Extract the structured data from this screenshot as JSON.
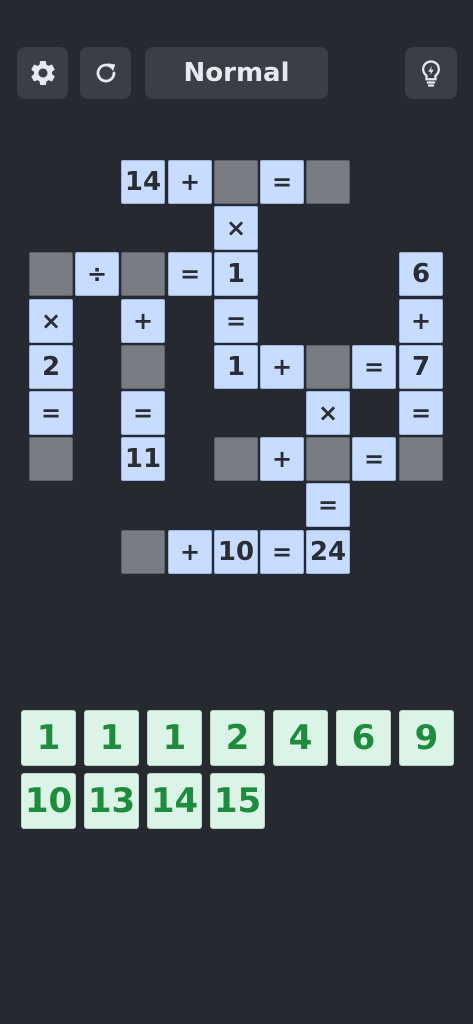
{
  "header": {
    "settings_icon": "gear-icon",
    "restart_icon": "restart-icon",
    "mode_label": "Normal",
    "hint_icon": "lightbulb-icon"
  },
  "board": {
    "cells": [
      {
        "row": 0,
        "col": 2,
        "kind": "fixed",
        "text": "14"
      },
      {
        "row": 0,
        "col": 3,
        "kind": "op",
        "text": "+"
      },
      {
        "row": 0,
        "col": 4,
        "kind": "empty",
        "text": ""
      },
      {
        "row": 0,
        "col": 5,
        "kind": "op",
        "text": "="
      },
      {
        "row": 0,
        "col": 6,
        "kind": "empty",
        "text": ""
      },
      {
        "row": 1,
        "col": 4,
        "kind": "op",
        "text": "×"
      },
      {
        "row": 2,
        "col": 0,
        "kind": "empty",
        "text": ""
      },
      {
        "row": 2,
        "col": 1,
        "kind": "op",
        "text": "÷"
      },
      {
        "row": 2,
        "col": 2,
        "kind": "empty",
        "text": ""
      },
      {
        "row": 2,
        "col": 3,
        "kind": "op",
        "text": "="
      },
      {
        "row": 2,
        "col": 4,
        "kind": "fixed",
        "text": "1"
      },
      {
        "row": 2,
        "col": 8,
        "kind": "fixed",
        "text": "6"
      },
      {
        "row": 3,
        "col": 0,
        "kind": "op",
        "text": "×"
      },
      {
        "row": 3,
        "col": 2,
        "kind": "op",
        "text": "+"
      },
      {
        "row": 3,
        "col": 4,
        "kind": "op",
        "text": "="
      },
      {
        "row": 3,
        "col": 8,
        "kind": "op",
        "text": "+"
      },
      {
        "row": 4,
        "col": 0,
        "kind": "fixed",
        "text": "2"
      },
      {
        "row": 4,
        "col": 2,
        "kind": "empty",
        "text": ""
      },
      {
        "row": 4,
        "col": 4,
        "kind": "fixed",
        "text": "1"
      },
      {
        "row": 4,
        "col": 5,
        "kind": "op",
        "text": "+"
      },
      {
        "row": 4,
        "col": 6,
        "kind": "empty",
        "text": ""
      },
      {
        "row": 4,
        "col": 7,
        "kind": "op",
        "text": "="
      },
      {
        "row": 4,
        "col": 8,
        "kind": "fixed",
        "text": "7"
      },
      {
        "row": 5,
        "col": 0,
        "kind": "op",
        "text": "="
      },
      {
        "row": 5,
        "col": 2,
        "kind": "op",
        "text": "="
      },
      {
        "row": 5,
        "col": 6,
        "kind": "op",
        "text": "×"
      },
      {
        "row": 5,
        "col": 8,
        "kind": "op",
        "text": "="
      },
      {
        "row": 6,
        "col": 0,
        "kind": "empty",
        "text": ""
      },
      {
        "row": 6,
        "col": 2,
        "kind": "fixed",
        "text": "11"
      },
      {
        "row": 6,
        "col": 4,
        "kind": "empty",
        "text": ""
      },
      {
        "row": 6,
        "col": 5,
        "kind": "op",
        "text": "+"
      },
      {
        "row": 6,
        "col": 6,
        "kind": "empty",
        "text": ""
      },
      {
        "row": 6,
        "col": 7,
        "kind": "op",
        "text": "="
      },
      {
        "row": 6,
        "col": 8,
        "kind": "empty",
        "text": ""
      },
      {
        "row": 7,
        "col": 6,
        "kind": "op",
        "text": "="
      },
      {
        "row": 8,
        "col": 2,
        "kind": "empty",
        "text": ""
      },
      {
        "row": 8,
        "col": 3,
        "kind": "op",
        "text": "+"
      },
      {
        "row": 8,
        "col": 4,
        "kind": "fixed",
        "text": "10"
      },
      {
        "row": 8,
        "col": 5,
        "kind": "op",
        "text": "="
      },
      {
        "row": 8,
        "col": 6,
        "kind": "fixed",
        "text": "24"
      }
    ]
  },
  "tray": {
    "tiles": [
      "1",
      "1",
      "1",
      "2",
      "4",
      "6",
      "9",
      "10",
      "13",
      "14",
      "15"
    ]
  },
  "colors": {
    "background": "#272930",
    "button": "#3b3e46",
    "cell_fixed": "#c7dcff",
    "cell_empty": "#7a7c83",
    "tile": "#dcf3e8",
    "tile_text": "#1e8c3d"
  }
}
